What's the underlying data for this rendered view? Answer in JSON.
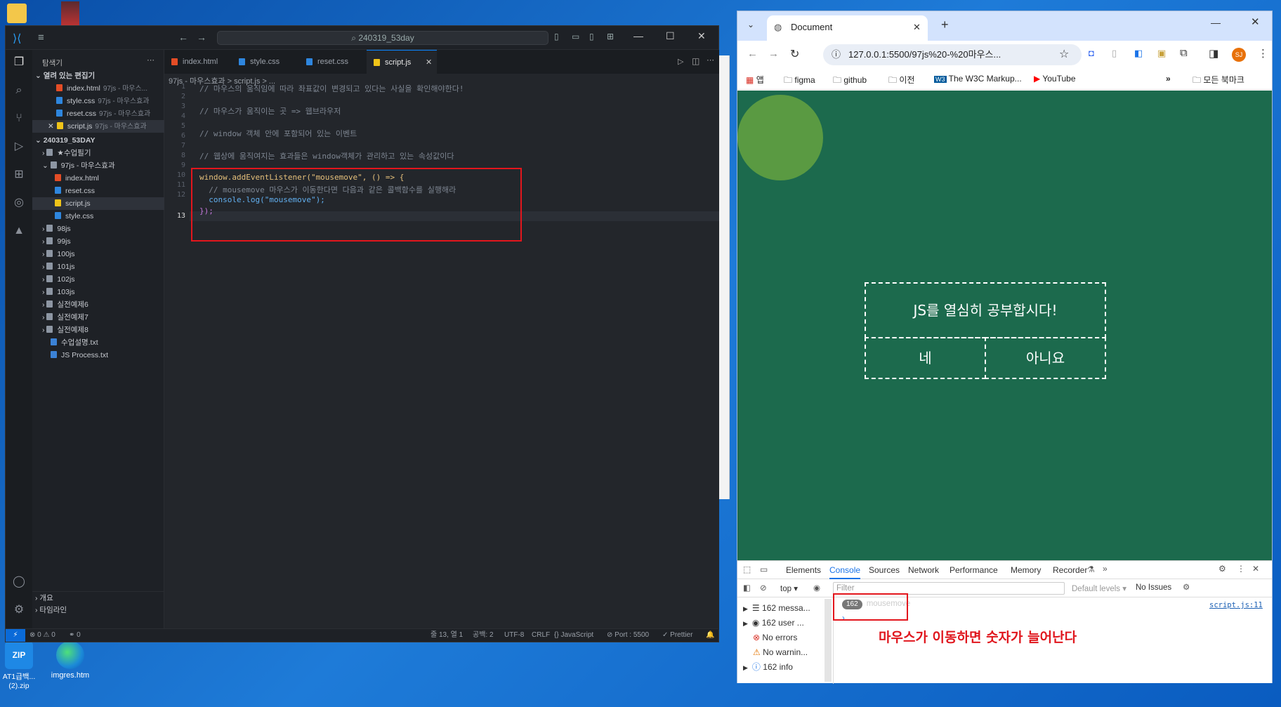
{
  "desktop": {
    "icons": [
      {
        "label": "AT1급백...\n(2).zip"
      },
      {
        "label": "imgres.htm"
      }
    ]
  },
  "vscode": {
    "search_text": "240319_53day",
    "explorer_title": "탐색기",
    "open_editors_label": "열려 있는 편집기",
    "open_editors": [
      {
        "name": "index.html",
        "sub": "97js - 마우스..."
      },
      {
        "name": "style.css",
        "sub": "97js - 마우스효과"
      },
      {
        "name": "reset.css",
        "sub": "97js - 마우스효과"
      },
      {
        "name": "script.js",
        "sub": "97js - 마우스효과"
      }
    ],
    "project_label": "240319_53DAY",
    "tree": [
      {
        "name": "★수업필기"
      },
      {
        "name": "97js - 마우스효과"
      },
      {
        "name": "index.html"
      },
      {
        "name": "reset.css"
      },
      {
        "name": "script.js"
      },
      {
        "name": "style.css"
      },
      {
        "name": "98js"
      },
      {
        "name": "99js"
      },
      {
        "name": "100js"
      },
      {
        "name": "101js"
      },
      {
        "name": "102js"
      },
      {
        "name": "103js"
      },
      {
        "name": "실전예제6"
      },
      {
        "name": "실전예제7"
      },
      {
        "name": "실전예제8"
      },
      {
        "name": "수업설명.txt"
      },
      {
        "name": "JS Process.txt"
      }
    ],
    "outline_label": "개요",
    "timeline_label": "타임라인",
    "tabs": [
      {
        "label": "index.html"
      },
      {
        "label": "style.css"
      },
      {
        "label": "reset.css"
      },
      {
        "label": "script.js"
      }
    ],
    "breadcrumb": "97js - 마우스효과  >  script.js  >  ...",
    "code_lines": [
      "// 마우스의 움직임에 따라 좌표값이 변경되고 있다는 사실을 확인해야한다!",
      "",
      "// 마우스가 움직이는 곳 => 웹브라우저",
      "",
      "// window 객체 안에 포함되어 있는 이벤트",
      "",
      "// 웹상에 움직여지는 효과들은 window객체가 관리하고 있는 속성값이다",
      "",
      "window.addEventListener(\"mousemove\", () => {",
      "  // mousemove 마우스가 이동한다면 다음과 같은 콜백함수를 실행해라",
      "  console.log(\"mousemove\");",
      "});",
      ""
    ],
    "status": {
      "problems": "⊗ 0 ⚠ 0",
      "ports": "⚭ 0",
      "position": "줄 13, 열 1",
      "spaces": "공백: 2",
      "encoding": "UTF-8",
      "eol": "CRLF",
      "language": "JavaScript",
      "port": "Port : 5500",
      "prettier": "Prettier"
    }
  },
  "chrome": {
    "tab_title": "Document",
    "url": "127.0.0.1:5500/97js%20-%20마우스...",
    "profile_initials": "SJ",
    "bookmarks": [
      {
        "label": "앱"
      },
      {
        "label": "figma"
      },
      {
        "label": "github"
      },
      {
        "label": "이전"
      },
      {
        "label": "The W3C Markup..."
      },
      {
        "label": "YouTube"
      }
    ],
    "all_bookmarks": "모든 북마크",
    "page": {
      "question": "JS를 열심히 공부합시다!",
      "yes": "네",
      "no": "아니요",
      "bg_color": "#1c6a4d",
      "circle_color": "#5a9a42"
    },
    "devtools": {
      "tabs": [
        "Elements",
        "Console",
        "Sources",
        "Network",
        "Performance",
        "Memory",
        "Recorder"
      ],
      "active_tab": "Console",
      "context": "top",
      "filter_placeholder": "Filter",
      "levels": "Default levels",
      "issues": "No Issues",
      "sidebar": [
        {
          "label": "162 messa..."
        },
        {
          "label": "162 user ..."
        },
        {
          "label": "No errors"
        },
        {
          "label": "No warnin..."
        },
        {
          "label": "162 info"
        }
      ],
      "log_count": "162",
      "log_text": "mousemove",
      "log_source": "script.js:11"
    }
  },
  "annotation": "마우스가 이동하면 숫자가 늘어난다"
}
